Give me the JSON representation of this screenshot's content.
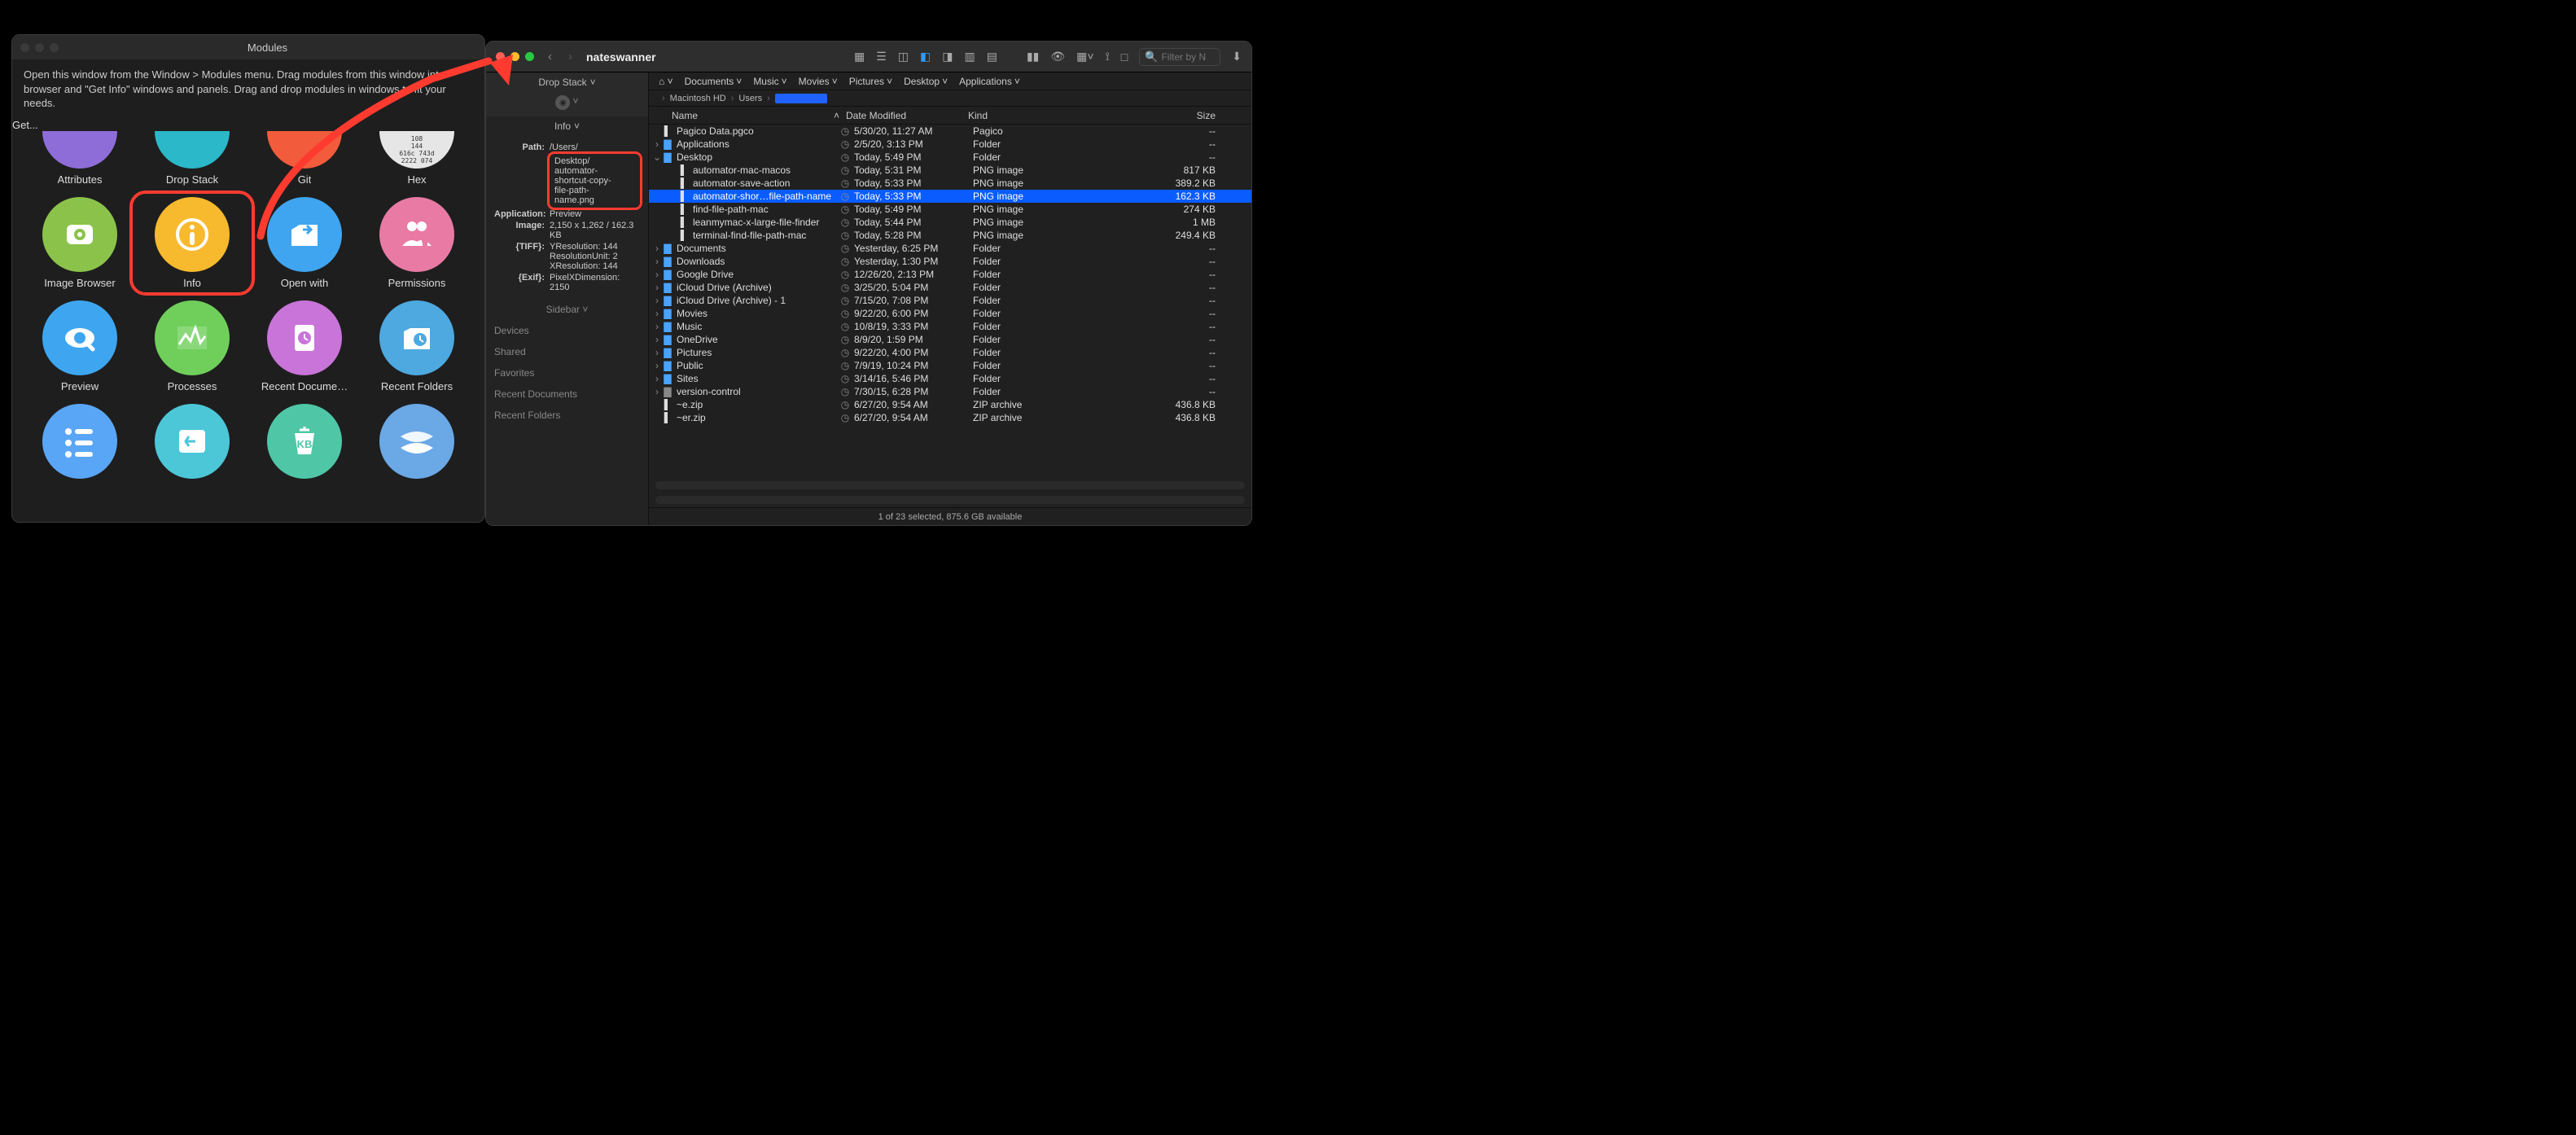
{
  "modules_window": {
    "title": "Modules",
    "hint": "Open this window from the Window > Modules menu. Drag modules from this window into browser and \"Get Info\" windows and panels. Drag and drop modules in windows to fit your needs.",
    "get_button": "Get...",
    "items": [
      {
        "label": "Attributes",
        "color": "c-attr"
      },
      {
        "label": "Drop Stack",
        "color": "c-drop"
      },
      {
        "label": "Git",
        "color": "c-git"
      },
      {
        "label": "Hex",
        "color": "c-hex"
      },
      {
        "label": "Image Browser",
        "color": "c-imgb"
      },
      {
        "label": "Info",
        "color": "c-info",
        "highlight": true
      },
      {
        "label": "Open with",
        "color": "c-open"
      },
      {
        "label": "Permissions",
        "color": "c-perm"
      },
      {
        "label": "Preview",
        "color": "c-prev"
      },
      {
        "label": "Processes",
        "color": "c-proc"
      },
      {
        "label": "Recent Docume…",
        "color": "c-rdoc"
      },
      {
        "label": "Recent Folders",
        "color": "c-rfold"
      }
    ],
    "hex_values": [
      "108",
      "144",
      "616c 743d",
      "2222 074"
    ]
  },
  "finder": {
    "title": "nateswanner",
    "search_placeholder": "Filter by N",
    "dropstack_label": "Drop Stack",
    "info_label": "Info",
    "sidebar_section": "Sidebar",
    "sidebar_groups": [
      "Devices",
      "Shared",
      "Favorites",
      "Recent Documents",
      "Recent Folders"
    ],
    "info": {
      "path_key": "Path:",
      "path_val": "/Users/",
      "path_highlight": "Desktop/\nautomator-\nshortcut-copy-\nfile-path-\nname.png",
      "app_key": "Application:",
      "app_val": "Preview",
      "image_key": "Image:",
      "image_val": "2,150 x 1,262 / 162.3 KB",
      "tiff_key": "{TIFF}:",
      "tiff_vals": [
        "YResolution: 144",
        "ResolutionUnit: 2",
        "XResolution: 144"
      ],
      "exif_key": "{Exif}:",
      "exif_vals": [
        "PixelXDimension:",
        "2150"
      ]
    },
    "favorites": [
      "Documents",
      "Music",
      "Movies",
      "Pictures",
      "Desktop",
      "Applications"
    ],
    "breadcrumb": [
      "Macintosh HD",
      "Users"
    ],
    "columns": {
      "name": "Name",
      "date": "Date Modified",
      "kind": "Kind",
      "size": "Size"
    },
    "rows": [
      {
        "icon": "file",
        "name": "Pagico Data.pgco",
        "date": "5/30/20, 11:27 AM",
        "kind": "Pagico",
        "size": "--",
        "indent": 0
      },
      {
        "icon": "folder",
        "name": "Applications",
        "date": "2/5/20, 3:13 PM",
        "kind": "Folder",
        "size": "--",
        "indent": 0,
        "chev": "›"
      },
      {
        "icon": "folder",
        "name": "Desktop",
        "date": "Today, 5:49 PM",
        "kind": "Folder",
        "size": "--",
        "indent": 0,
        "chev": "⌄"
      },
      {
        "icon": "file",
        "name": "automator-mac-macos",
        "date": "Today, 5:31 PM",
        "kind": "PNG image",
        "size": "817 KB",
        "indent": 1
      },
      {
        "icon": "file",
        "name": "automator-save-action",
        "date": "Today, 5:33 PM",
        "kind": "PNG image",
        "size": "389.2 KB",
        "indent": 1
      },
      {
        "icon": "file",
        "name": "automator-shor…file-path-name",
        "date": "Today, 5:33 PM",
        "kind": "PNG image",
        "size": "162.3 KB",
        "indent": 1,
        "selected": true
      },
      {
        "icon": "file",
        "name": "find-file-path-mac",
        "date": "Today, 5:49 PM",
        "kind": "PNG image",
        "size": "274 KB",
        "indent": 1
      },
      {
        "icon": "file",
        "name": "leanmymac-x-large-file-finder",
        "date": "Today, 5:44 PM",
        "kind": "PNG image",
        "size": "1 MB",
        "indent": 1
      },
      {
        "icon": "file",
        "name": "terminal-find-file-path-mac",
        "date": "Today, 5:28 PM",
        "kind": "PNG image",
        "size": "249.4 KB",
        "indent": 1
      },
      {
        "icon": "folder",
        "name": "Documents",
        "date": "Yesterday, 6:25 PM",
        "kind": "Folder",
        "size": "--",
        "indent": 0,
        "chev": "›"
      },
      {
        "icon": "folder",
        "name": "Downloads",
        "date": "Yesterday, 1:30 PM",
        "kind": "Folder",
        "size": "--",
        "indent": 0,
        "chev": "›"
      },
      {
        "icon": "folder",
        "name": "Google Drive",
        "date": "12/26/20, 2:13 PM",
        "kind": "Folder",
        "size": "--",
        "indent": 0,
        "chev": "›"
      },
      {
        "icon": "folder",
        "name": "iCloud Drive (Archive)",
        "date": "3/25/20, 5:04 PM",
        "kind": "Folder",
        "size": "--",
        "indent": 0,
        "chev": "›"
      },
      {
        "icon": "folder",
        "name": "iCloud Drive (Archive) - 1",
        "date": "7/15/20, 7:08 PM",
        "kind": "Folder",
        "size": "--",
        "indent": 0,
        "chev": "›"
      },
      {
        "icon": "folder",
        "name": "Movies",
        "date": "9/22/20, 6:00 PM",
        "kind": "Folder",
        "size": "--",
        "indent": 0,
        "chev": "›"
      },
      {
        "icon": "folder",
        "name": "Music",
        "date": "10/8/19, 3:33 PM",
        "kind": "Folder",
        "size": "--",
        "indent": 0,
        "chev": "›"
      },
      {
        "icon": "folder",
        "name": "OneDrive",
        "date": "8/9/20, 1:59 PM",
        "kind": "Folder",
        "size": "--",
        "indent": 0,
        "chev": "›"
      },
      {
        "icon": "folder",
        "name": "Pictures",
        "date": "9/22/20, 4:00 PM",
        "kind": "Folder",
        "size": "--",
        "indent": 0,
        "chev": "›"
      },
      {
        "icon": "folder",
        "name": "Public",
        "date": "7/9/19, 10:24 PM",
        "kind": "Folder",
        "size": "--",
        "indent": 0,
        "chev": "›"
      },
      {
        "icon": "folder",
        "name": "Sites",
        "date": "3/14/16, 5:46 PM",
        "kind": "Folder",
        "size": "--",
        "indent": 0,
        "chev": "›"
      },
      {
        "icon": "folder-plain",
        "name": "version-control",
        "date": "7/30/15, 6:28 PM",
        "kind": "Folder",
        "size": "--",
        "indent": 0,
        "chev": "›"
      },
      {
        "icon": "file",
        "name": "~e.zip",
        "date": "6/27/20, 9:54 AM",
        "kind": "ZIP archive",
        "size": "436.8 KB",
        "indent": 0
      },
      {
        "icon": "file",
        "name": "~er.zip",
        "date": "6/27/20, 9:54 AM",
        "kind": "ZIP archive",
        "size": "436.8 KB",
        "indent": 0
      }
    ],
    "status": "1 of 23 selected, 875.6 GB available"
  }
}
